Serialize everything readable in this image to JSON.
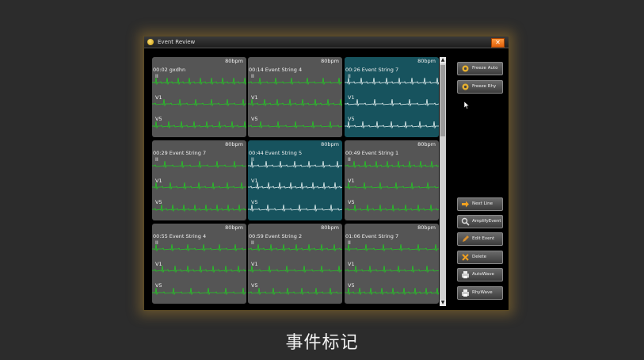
{
  "window": {
    "title": "Event Review",
    "close_glyph": "✕"
  },
  "tiles": [
    {
      "bpm": "80bpm",
      "title": "00:02 gxdhn",
      "leads": [
        "II",
        "V1",
        "V5"
      ],
      "selected": false
    },
    {
      "bpm": "80bpm",
      "title": "00:14 Event String 4",
      "leads": [
        "II",
        "V1",
        "V5"
      ],
      "selected": false
    },
    {
      "bpm": "80bpm",
      "title": "00:26 Event String 7",
      "leads": [
        "II",
        "V1",
        "V5"
      ],
      "selected": true
    },
    {
      "bpm": "80bpm",
      "title": "00:29 Event String 7",
      "leads": [
        "II",
        "V1",
        "V5"
      ],
      "selected": false
    },
    {
      "bpm": "80bpm",
      "title": "00:44 Event String 5",
      "leads": [
        "II",
        "V1",
        "V5"
      ],
      "selected": true
    },
    {
      "bpm": "80bpm",
      "title": "00:49 Event String 1",
      "leads": [
        "II",
        "V1",
        "V5"
      ],
      "selected": false
    },
    {
      "bpm": "80bpm",
      "title": "00:55 Event String 4",
      "leads": [
        "II",
        "V1",
        "V5"
      ],
      "selected": false
    },
    {
      "bpm": "80bpm",
      "title": "00:59 Event String 2",
      "leads": [
        "II",
        "V1",
        "V5"
      ],
      "selected": false
    },
    {
      "bpm": "80bpm",
      "title": "01:06 Event String 7",
      "leads": [
        "II",
        "V1",
        "V5"
      ],
      "selected": false
    }
  ],
  "buttons": [
    {
      "label": "Freeze Auto",
      "icon": "freeze-icon"
    },
    {
      "label": "Freeze Rhy",
      "icon": "freeze-icon"
    },
    {
      "label": "Next Line",
      "icon": "arrow-right-icon"
    },
    {
      "label": "AmplifyEvent",
      "icon": "magnifier-icon"
    },
    {
      "label": "Edit Event",
      "icon": "pencil-icon"
    },
    {
      "label": "Delete",
      "icon": "delete-x-icon"
    },
    {
      "label": "AutoWave",
      "icon": "printer-icon"
    },
    {
      "label": "RhyWave",
      "icon": "printer-icon"
    }
  ],
  "scrollbar": {
    "up_glyph": "▲",
    "down_glyph": "▼"
  },
  "caption": "事件标记",
  "colors": {
    "wave_normal": "#22cc22",
    "wave_selected": "#e8f4f4",
    "tile_bg": "#555555",
    "tile_selected_bg": "#17535e"
  }
}
